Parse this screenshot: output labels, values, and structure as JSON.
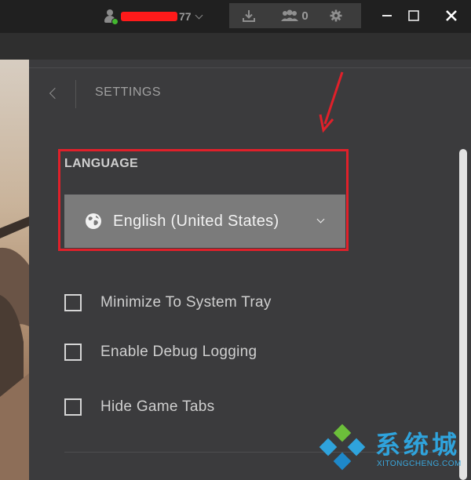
{
  "titlebar": {
    "user_name_suffix": "77",
    "friends_count": "0",
    "icons": [
      "user-icon",
      "download-icon",
      "friends-icon",
      "gear-icon",
      "minimize-icon",
      "maximize-icon",
      "close-icon"
    ]
  },
  "settings": {
    "title": "SETTINGS",
    "language": {
      "label": "LANGUAGE",
      "selected": "English (United States)"
    },
    "options": [
      {
        "label": "Minimize To System Tray",
        "checked": false
      },
      {
        "label": "Enable Debug Logging",
        "checked": false
      },
      {
        "label": "Hide Game Tabs",
        "checked": false
      }
    ]
  },
  "watermark": {
    "title": "系统城",
    "subtitle": "XITONGCHENG.COM"
  },
  "colors": {
    "highlight": "#e0202a",
    "online": "#43b72f",
    "watermark": "#2fa3dc"
  }
}
